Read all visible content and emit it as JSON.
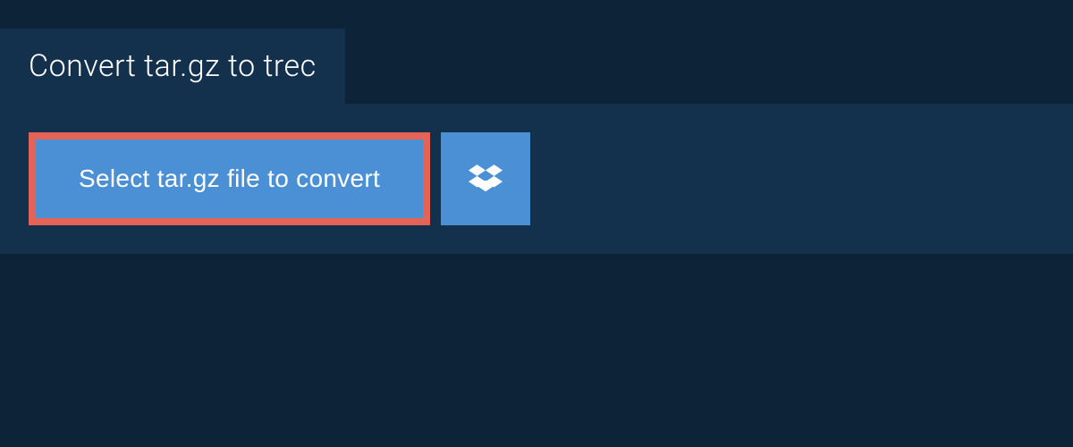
{
  "header": {
    "title": "Convert tar.gz to trec"
  },
  "actions": {
    "select_file_label": "Select tar.gz file to convert",
    "dropbox_icon_name": "dropbox-icon"
  },
  "colors": {
    "background": "#0d2438",
    "panel": "#13314d",
    "button": "#4b90d5",
    "highlight_border": "#e56356",
    "text": "#ffffff"
  }
}
